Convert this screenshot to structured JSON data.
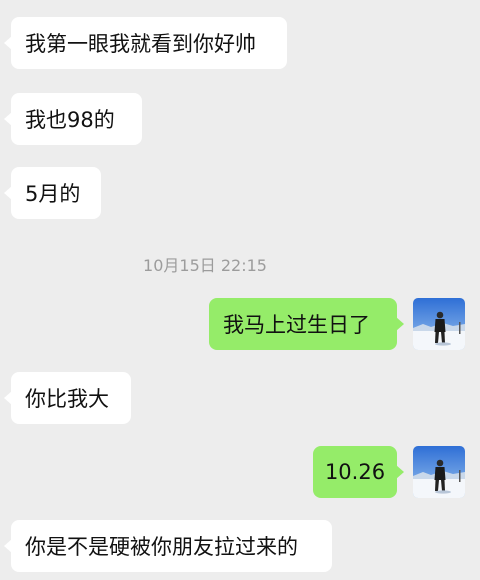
{
  "messages": [
    {
      "side": "in",
      "text": "我第一眼我就看到你好帅"
    },
    {
      "side": "in",
      "text": "我也98的"
    },
    {
      "side": "in",
      "text": "5月的"
    },
    {
      "side": "out",
      "text": "我马上过生日了"
    },
    {
      "side": "in",
      "text": "你比我大"
    },
    {
      "side": "out",
      "text": "10.26"
    },
    {
      "side": "in",
      "text": "你是不是硬被你朋友拉过来的"
    }
  ],
  "timestamp": "10月15日 22:15",
  "colors": {
    "background": "#ededed",
    "incoming_bubble": "#ffffff",
    "outgoing_bubble": "#95ec69",
    "timestamp_text": "#9c9c9c"
  },
  "avatar_icon": "snow-landscape-person"
}
